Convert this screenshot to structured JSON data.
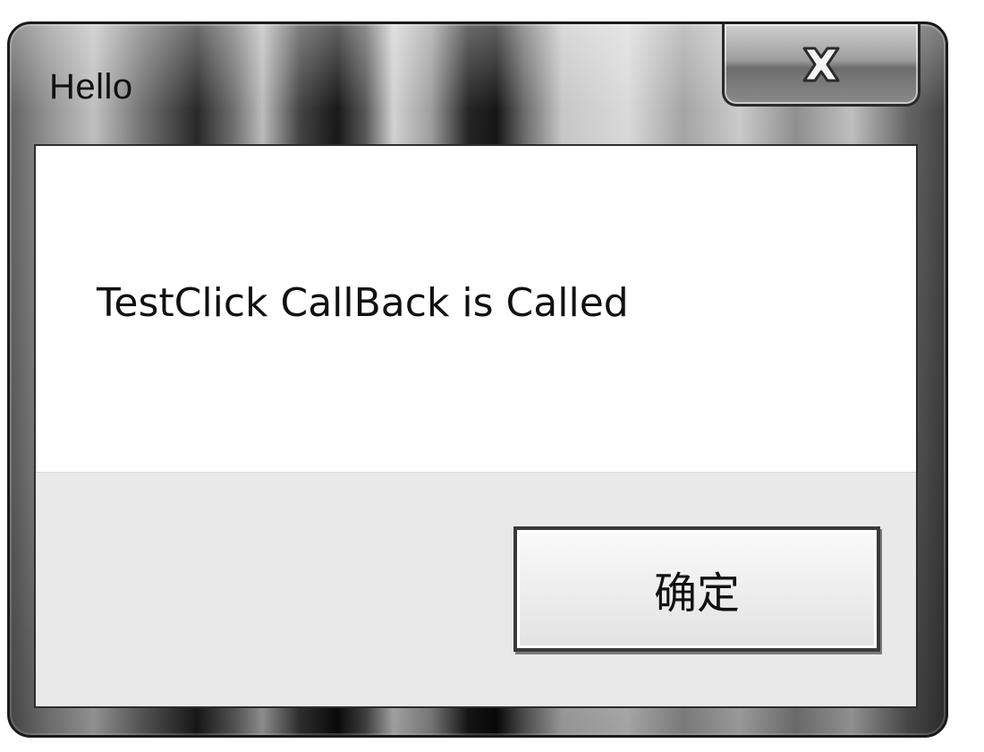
{
  "window": {
    "title": "Hello",
    "close_icon": "close-icon"
  },
  "dialog": {
    "message": "TestClick CallBack is Called",
    "ok_button_label": "确定"
  }
}
